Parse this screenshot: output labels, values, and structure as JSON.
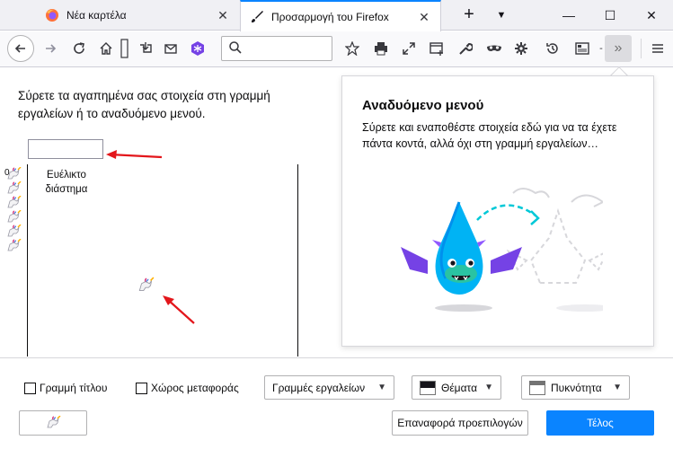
{
  "tabs": [
    {
      "label": "Νέα καρτέλα",
      "active": false
    },
    {
      "label": "Προσαρμογή του Firefox",
      "active": true
    }
  ],
  "window_controls": {
    "minimize": "—",
    "maximize": "☐",
    "close": "✕"
  },
  "toolbar": {
    "icons": [
      "back-icon",
      "forward-icon",
      "reload-icon",
      "home-icon",
      "library-icon",
      "save-to-pocket-icon",
      "email-icon",
      "extension-icon",
      "search-icon",
      "bookmark-star-icon",
      "print-icon",
      "fullscreen-icon",
      "new-window-icon",
      "customize-wrench-icon",
      "private-mask-icon",
      "gear-icon",
      "history-icon",
      "sidebar-icon",
      "overflow-chevron-icon",
      "hamburger-menu-icon"
    ]
  },
  "main": {
    "instruction": "Σύρετε τα αγαπημένα σας στοιχεία στη γραμμή εργαλείων ή το αναδυόμενο μενού.",
    "flex_item_label": "Ευέλικτο διάστημα",
    "zero_label": "0"
  },
  "panel": {
    "title": "Αναδυόμενο μενού",
    "description": "Σύρετε και εναποθέστε στοιχεία εδώ για να τα έχετε πάντα κοντά, αλλά όχι στη γραμμή εργαλείων…"
  },
  "footer": {
    "title_bar_label": "Γραμμή τίτλου",
    "drag_space_label": "Χώρος μεταφοράς",
    "toolbars_label": "Γραμμές εργαλείων",
    "themes_label": "Θέματα",
    "density_label": "Πυκνότητα",
    "restore_label": "Επαναφορά προεπιλογών",
    "done_label": "Τέλος"
  },
  "colors": {
    "accent": "#0a84ff",
    "arrow": "#e3161b"
  }
}
